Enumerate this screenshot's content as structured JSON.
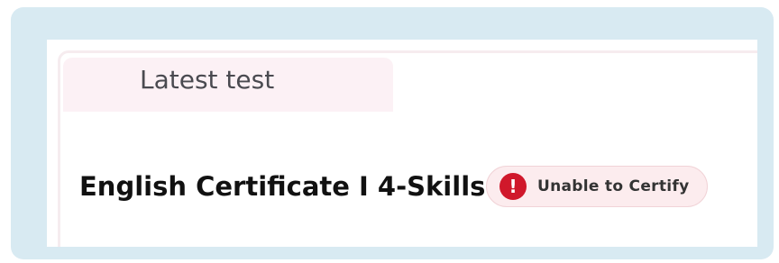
{
  "tab": {
    "label": "Latest test"
  },
  "certificate": {
    "title": "English Certificate I 4-Skills",
    "status": {
      "label": "Unable to Certify",
      "icon": "exclamation-icon",
      "icon_glyph": "!",
      "color": "#d0182b",
      "background": "#fcecee"
    }
  },
  "colors": {
    "frame": "#d8eaf2",
    "tab_background": "#fcf1f5",
    "card_border": "#f6ecef"
  }
}
